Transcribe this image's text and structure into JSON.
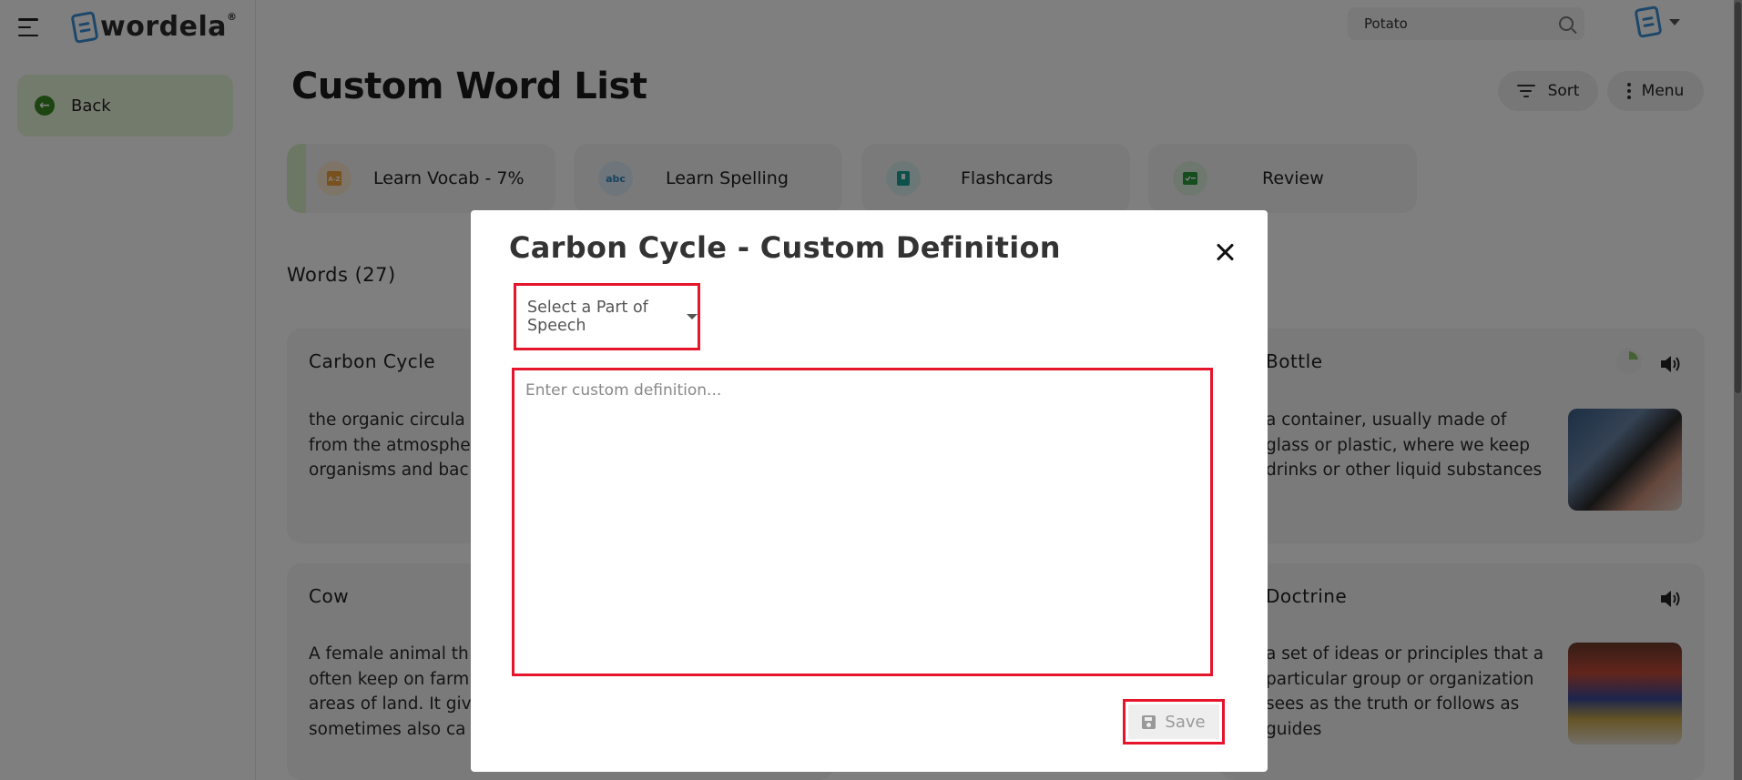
{
  "app": {
    "brand": "wordela",
    "brand_mark": "®"
  },
  "sidebar": {
    "back_label": "Back"
  },
  "topbar": {
    "search_value": "Potato"
  },
  "page": {
    "title": "Custom Word List",
    "sort_label": "Sort",
    "menu_label": "Menu",
    "words_count": "Words (27)"
  },
  "modes": [
    {
      "label": "Learn Vocab - 7%",
      "icon": "vocab-icon",
      "color": "#f2a33a",
      "progress_percent": 7
    },
    {
      "label": "Learn Spelling",
      "icon": "abc-check-icon",
      "color": "#2e86c1"
    },
    {
      "label": "Flashcards",
      "icon": "flashcard-icon",
      "color": "#1aa39b"
    },
    {
      "label": "Review",
      "icon": "review-icon",
      "color": "#2b9a3c"
    }
  ],
  "cards": [
    {
      "title": "Carbon Cycle",
      "definition": "the organic circula\nfrom the atmosphe\norganisms and bac"
    },
    {
      "title": "Bottle",
      "definition": "a container, usually made of\nglass or plastic, where we keep\ndrinks or other liquid substances"
    },
    {
      "title": "Cow",
      "definition": "A female animal th\noften keep on farm\nareas of land. It giv\nsometimes also ca"
    },
    {
      "title": "Doctrine",
      "definition": "a set of ideas or principles that a\nparticular group or organization\nsees as the truth or follows as\nguides"
    }
  ],
  "modal": {
    "title": "Carbon Cycle - Custom Definition",
    "part_of_speech_label": "Select a Part of Speech",
    "definition_placeholder": "Enter custom definition...",
    "definition_value": "",
    "save_label": "Save"
  },
  "colors": {
    "accent_green": "#3a8a23",
    "highlight_red": "#e5162b",
    "brand_blue": "#3b8fd4"
  }
}
